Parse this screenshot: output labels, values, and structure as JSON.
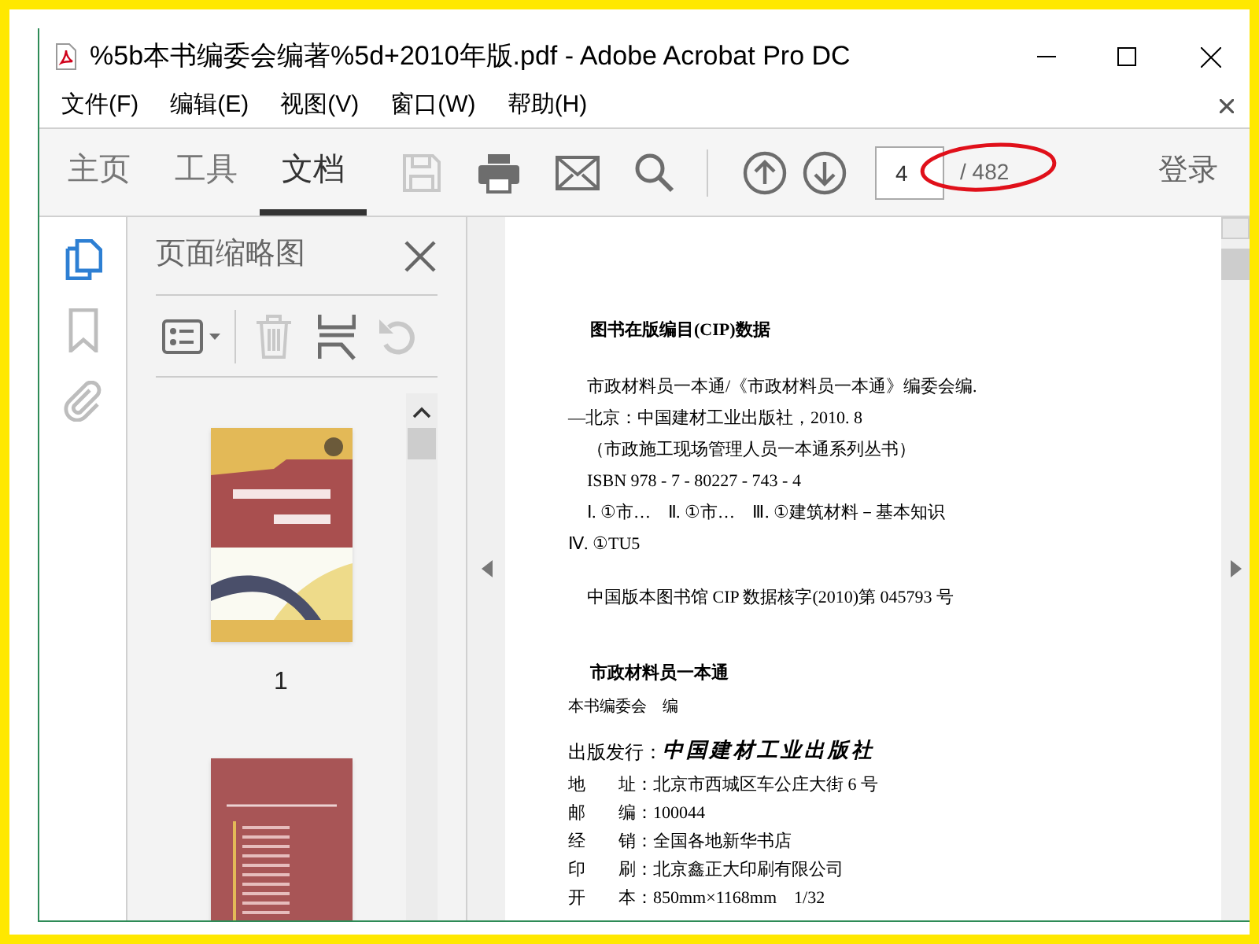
{
  "window": {
    "title": "%5b本书编委会编著%5d+2010年版.pdf - Adobe Acrobat Pro DC"
  },
  "menu": [
    "文件(F)",
    "编辑(E)",
    "视图(V)",
    "窗口(W)",
    "帮助(H)"
  ],
  "tabs": [
    {
      "label": "主页",
      "selected": false
    },
    {
      "label": "工具",
      "selected": false
    },
    {
      "label": "文档",
      "selected": true
    }
  ],
  "page_field": {
    "value": "4"
  },
  "page_total": {
    "text": "/ 482",
    "circled": true
  },
  "sign_in": "登录",
  "side_nav": [
    {
      "kind": "pages",
      "selected": true
    },
    {
      "kind": "bookmark",
      "selected": false
    },
    {
      "kind": "attachment",
      "selected": false
    }
  ],
  "side_panel": {
    "title": "页面缩略图",
    "thumbnails": [
      {
        "kind": "front",
        "label": "1"
      },
      {
        "kind": "back"
      }
    ]
  },
  "document": [
    {
      "kind": "heading",
      "text": "图书在版编目(CIP)数据"
    },
    {
      "kind": "gap"
    },
    {
      "kind": "indent",
      "text": "市政材料员一本通/《市政材料员一本通》编委会编."
    },
    {
      "kind": "plain",
      "text": "—北京：中国建材工业出版社，2010. 8"
    },
    {
      "kind": "indent",
      "text": "（市政施工现场管理人员一本通系列丛书）"
    },
    {
      "kind": "indent",
      "text": "ISBN 978 - 7 - 80227 - 743 - 4"
    },
    {
      "kind": "indent",
      "text": "Ⅰ. ①市…　Ⅱ. ①市…　Ⅲ. ①建筑材料－基本知识"
    },
    {
      "kind": "plain",
      "text": "Ⅳ. ①TU5"
    },
    {
      "kind": "gap"
    },
    {
      "kind": "indent",
      "text": "中国版本图书馆 CIP 数据核字(2010)第 045793 号"
    },
    {
      "kind": "gap"
    },
    {
      "kind": "gap"
    },
    {
      "kind": "heading",
      "text": "市政材料员一本通"
    },
    {
      "kind": "small",
      "text": "本书编委会　编"
    },
    {
      "kind": "publisher",
      "label": "出版发行：",
      "value": "中国建材工业出版社"
    },
    {
      "kind": "field",
      "head": "地",
      "tail": "址：",
      "value": "北京市西城区车公庄大街 6 号"
    },
    {
      "kind": "field",
      "head": "邮",
      "tail": "编：",
      "value": "100044"
    },
    {
      "kind": "field",
      "head": "经",
      "tail": "销：",
      "value": "全国各地新华书店"
    },
    {
      "kind": "field",
      "head": "印",
      "tail": "刷：",
      "value": "北京鑫正大印刷有限公司"
    },
    {
      "kind": "field",
      "head": "开",
      "tail": "本：",
      "value": "850mm×1168mm　1/32"
    }
  ]
}
